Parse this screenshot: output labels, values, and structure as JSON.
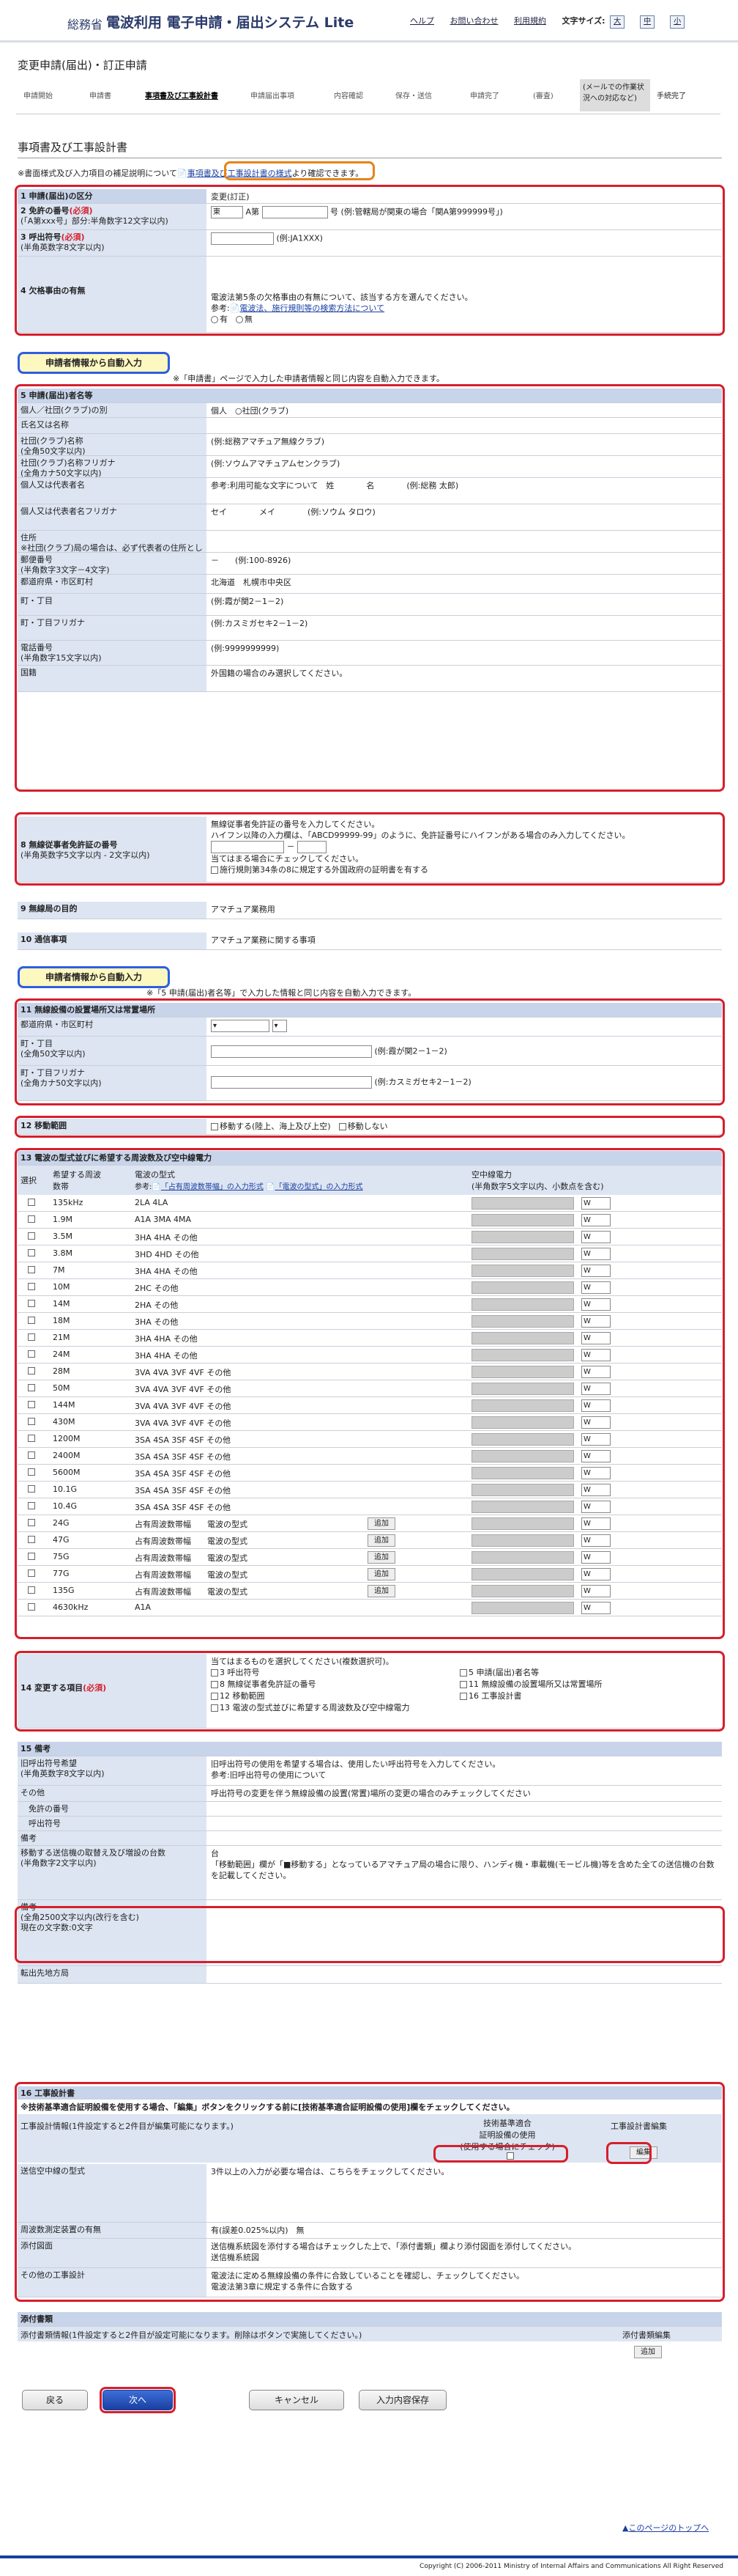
{
  "header": {
    "brand_small": "総務省",
    "brand": "電波利用 電子申請・届出システム Lite",
    "links": [
      "ヘルプ",
      "お問い合わせ",
      "利用規約"
    ],
    "font_label": "文字サイズ:",
    "font_sizes": [
      "大",
      "中",
      "小"
    ]
  },
  "page_title": "変更申請(届出)・訂正申請",
  "steps": [
    "申請開始",
    "申請書",
    "事項書及び工事設計書",
    "申請届出事項",
    "内容確認",
    "保存・送信",
    "申請完了",
    "(審査)"
  ],
  "step_box": "(メールでの作業状況への対応など)",
  "step_last": "手続完了",
  "section_title": "事項書及び工事設計書",
  "note": {
    "pre": "※書面様式及び入力項目の補足説明について",
    "link": "事項書及び工事設計書の様式",
    "post": "より確認できます。"
  },
  "s1": {
    "label": "1 申請(届出)の区分",
    "value": "変更(訂正)"
  },
  "s2": {
    "label": "2 免許の番号",
    "req": "(必須)",
    "sub": "(「A第xxx号」部分:半角数字12文字以内)",
    "pref": "東",
    "mid": "A第",
    "suf": "号",
    "ex": "(例:管轄局が関東の場合「関A第999999号」)"
  },
  "s3": {
    "label": "3 呼出符号",
    "req": "(必須)",
    "sub": "(半角英数字8文字以内)",
    "ex": "(例:JA1XXX)"
  },
  "s4": {
    "label": "4 欠格事由の有無",
    "text": "電波法第5条の欠格事由の有無について、該当する方を選んでください。",
    "ref": "参考:",
    "link": "電波法、施行規則等の検索方法について",
    "opts": [
      "有",
      "無"
    ]
  },
  "auto1": {
    "badge": "申請者情報から自動入力",
    "note": "※「申請書」ページで入力した申請者情報と同じ内容を自動入力できます。"
  },
  "s5": {
    "label": "5 申請(届出)者名等",
    "rows": [
      {
        "l": "個人／社団(クラブ)の別",
        "req": "(必須)",
        "v": "個人　○社団(クラブ)"
      },
      {
        "l": "氏名又は名称",
        "v": ""
      },
      {
        "l": "社団(クラブ)名称\n(全角50文字以内)",
        "v": "(例:総務アマチュア無線クラブ)"
      },
      {
        "l": "社団(クラブ)名称フリガナ\n(全角カナ50文字以内)",
        "v": "(例:ソウムアマチュアムセンクラブ)"
      },
      {
        "l": "個人又は代表者名",
        "req": "(必須)",
        "sub": "(全角姓名25文字以内)",
        "v": "参考:利用可能な文字について　姓　　　　名　　　　(例:総務 太郎)"
      },
      {
        "l": "個人又は代表者名フリガナ",
        "req": "(必須)",
        "sub": "(全角カナ25文字以内)",
        "v": "セイ　　　　メイ　　　　(例:ソウム タロウ)"
      },
      {
        "l": "住所\n※社団(クラブ)局の場合は、必ず代表者の住所としてください。",
        "v": ""
      },
      {
        "l": "郵便番号\n(半角数字3文字－4文字)",
        "v": "－　　(例:100-8926)"
      },
      {
        "l": "都道府県・市区町村",
        "req": "(必須)",
        "v": "北海道　札幌市中央区"
      },
      {
        "l": "町・丁目",
        "req": "(必須)",
        "sub": "(全角50文字以内)",
        "v": "(例:霞が関2－1－2)"
      },
      {
        "l": "町・丁目フリガナ",
        "req": "(必須)",
        "sub": "(全角カナ50文字以内)",
        "v": "(例:カスミガセキ2－1－2)"
      },
      {
        "l": "電話番号\n(半角数字15文字以内)",
        "v": "(例:9999999999)"
      },
      {
        "l": "国籍",
        "v": "外国籍の場合のみ選択してください。"
      }
    ]
  },
  "s8": {
    "label": "8 無線従事者免許証の番号",
    "sub": "(半角英数字5文字以内 - 2文字以内)",
    "lines": [
      "無線従事者免許証の番号を入力してください。",
      "ハイフン以降の入力欄は、「ABCD99999-99」のように、免許証番号にハイフンがある場合のみ入力してください。",
      "当てはまる場合にチェックしてください。",
      "施行規則第34条の8に規定する外国政府の証明書を有する"
    ]
  },
  "s9": {
    "label": "9 無線局の目的",
    "value": "アマチュア業務用"
  },
  "s10": {
    "label": "10 通信事項",
    "value": "アマチュア業務に関する事項"
  },
  "auto2": {
    "badge": "申請者情報から自動入力",
    "note": "※「5 申請(届出)者名等」で入力した情報と同じ内容を自動入力できます。"
  },
  "s11": {
    "label": "11 無線設備の設置場所又は常置場所",
    "rows": [
      "都道府県・市区町村",
      "町・丁目\n(全角50文字以内)",
      "町・丁目フリガナ\n(全角カナ50文字以内)"
    ],
    "ex": [
      "(例:霞が関2－1－2)",
      "(例:カスミガセキ2－1－2)"
    ]
  },
  "s12": {
    "label": "12 移動範囲",
    "opts": [
      "移動する(陸上、海上及び上空)",
      "移動しない"
    ]
  },
  "s13": {
    "label": "13 電波の型式並びに希望する周波数及び空中線電力",
    "cols": [
      "選択",
      "希望する周波数帯",
      "電波の型式",
      "空中線電力\n(半角数字5文字以内、小数点を含む)"
    ],
    "ref": "参考:",
    "ref_links": [
      "「占有周波数帯幅」の入力形式",
      "「電波の型式」の入力形式"
    ],
    "bands": [
      "135kHz",
      "1.9M",
      "3.5M",
      "3.8M",
      "7M",
      "10M",
      "14M",
      "18M",
      "21M",
      "24M",
      "28M",
      "50M",
      "144M",
      "430M",
      "1200M",
      "2400M",
      "5600M",
      "10.1G",
      "10.4G",
      "24G",
      "47G",
      "75G",
      "77G",
      "135G",
      "4630kHz"
    ],
    "types": [
      "2LA 4LA",
      "A1A 3MA 4MA",
      "3HA 4HA その他",
      "3HD 4HD その他",
      "3HA 4HA その他",
      "2HC その他",
      "2HA その他",
      "3HA その他",
      "3HA 4HA その他",
      "3HA 4HA その他",
      "3VA 4VA 3VF 4VF その他",
      "3VA 4VA 3VF 4VF その他",
      "3VA 4VA 3VF 4VF その他",
      "3VA 4VA 3VF 4VF その他",
      "3SA 4SA 3SF 4SF その他",
      "3SA 4SA 3SF 4SF その他",
      "3SA 4SA 3SF 4SF その他",
      "3SA 4SA 3SF 4SF その他",
      "3SA 4SA 3SF 4SF その他",
      "占有周波数帯幅　　電波の型式",
      "占有周波数帯幅　　電波の型式",
      "占有周波数帯幅　　電波の型式",
      "占有周波数帯幅　　電波の型式",
      "占有周波数帯幅　　電波の型式",
      "A1A"
    ],
    "unit": "W",
    "add": "追加"
  },
  "s14": {
    "label": "14 変更する項目",
    "req": "(必須)",
    "intro": "当てはまるものを選択してください(複数選択可)。",
    "items": [
      "3 呼出符号",
      "5 申請(届出)者名等",
      "8 無線従事者免許証の番号",
      "11 無線設備の設置場所又は常置場所",
      "12 移動範囲",
      "16 工事設計書",
      "13 電波の型式並びに希望する周波数及び空中線電力"
    ]
  },
  "s15": {
    "label": "15 備考",
    "rows": [
      {
        "l": "旧呼出符号希望\n(半角英数字8文字以内)",
        "v": "旧呼出符号の使用を希望する場合は、使用したい呼出符号を入力してください。\n参考:旧呼出符号の使用について"
      },
      {
        "l": "その他",
        "v": "呼出符号の変更を伴う無線設備の設置(常置)場所の変更の場合のみチェックしてください"
      },
      {
        "l": "　免許の番号",
        "v": ""
      },
      {
        "l": "　呼出符号",
        "v": ""
      },
      {
        "l": "備考",
        "v": ""
      },
      {
        "l": "移動する送信機の取替え及び増設の台数\n(半角数字2文字以内)",
        "v": "台\n「移動範囲」欄が「■移動する」となっているアマチュア局の場合に限り、ハンディ機・車載機(モービル機)等を含めた全ての送信機の台数を記載してください。"
      },
      {
        "l": "備考\n(全角2500文字以内(改行を含む)\n現在の文字数:0文字",
        "v": ""
      },
      {
        "l": "転出先地方局",
        "v": ""
      }
    ]
  },
  "s16": {
    "label": "16 工事設計書",
    "notice": "※技術基準適合証明設備を使用する場合、「編集」ボタンをクリックする前に[技術基準適合証明設備の使用]欄をチェックしてください。",
    "info": "工事設計情報(1件設定すると2件目が編集可能になります。)",
    "col1": "技術基準適合\n証明設備の使用\n(使用する場合にチェック)",
    "col2": "工事設計書編集",
    "edit": "編集",
    "rows": [
      {
        "l": "送信空中線の型式",
        "v": "3件以上の入力が必要な場合は、こちらをチェックしてください。"
      },
      {
        "l": "周波数測定装置の有無",
        "v": "有(誤差0.025%以内)　無"
      },
      {
        "l": "添付図面",
        "v": "送信機系統図を添付する場合はチェックした上で、「添付書類」欄より添付図面を添付してください。\n送信機系統図"
      },
      {
        "l": "その他の工事設計",
        "v": "電波法に定める無線設備の条件に合致していることを確認し、チェックしてください。\n電波法第3章に規定する条件に合致する"
      }
    ]
  },
  "attach": {
    "label": "添付書類",
    "info": "添付書類情報(1件設定すると2件目が設定可能になります。削除はボタンで実施してください。)",
    "col": "添付書類編集",
    "add": "追加"
  },
  "buttons": {
    "back": "戻る",
    "next": "次へ",
    "cancel": "キャンセル",
    "save": "入力内容保存"
  },
  "top_link": "このページのトップへ",
  "copyright": "Copyright (C) 2006-2011 Ministry of Internal Affairs and Communications All Right Reserved"
}
